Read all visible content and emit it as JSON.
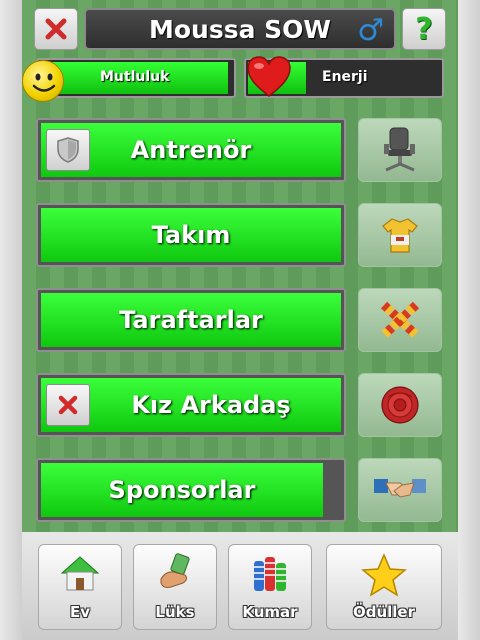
{
  "header": {
    "player_name": "Moussa SOW",
    "gender_symbol": "♂",
    "help_symbol": "?"
  },
  "meters": {
    "happiness": {
      "label": "Mutluluk",
      "level": 0.98
    },
    "energy": {
      "label": "Enerji",
      "level": 0.3
    }
  },
  "menu": {
    "rows": [
      {
        "label": "Antrenör",
        "tile": "office-chair-icon",
        "level": 1.0
      },
      {
        "label": "Takım",
        "tile": "jersey-icon",
        "level": 1.0
      },
      {
        "label": "Taraftarlar",
        "tile": "scarf-icon",
        "level": 1.0
      },
      {
        "label": "Kız Arkadaş",
        "tile": "rose-icon",
        "level": 1.0
      },
      {
        "label": "Sponsorlar",
        "tile": "handshake-icon",
        "level": 0.94
      }
    ]
  },
  "bottom_nav": {
    "items": [
      {
        "label": "Ev",
        "icon": "house-icon"
      },
      {
        "label": "Lüks",
        "icon": "money-hand-icon"
      },
      {
        "label": "Kumar",
        "icon": "poker-chips-icon"
      },
      {
        "label": "Ödüller",
        "icon": "star-icon"
      }
    ]
  },
  "colors": {
    "bar_green": "#22e022",
    "background_green": "#5f9e5d",
    "close_red": "#d12b2b",
    "help_green": "#2fb52f",
    "gender_blue": "#2e8ad6"
  }
}
